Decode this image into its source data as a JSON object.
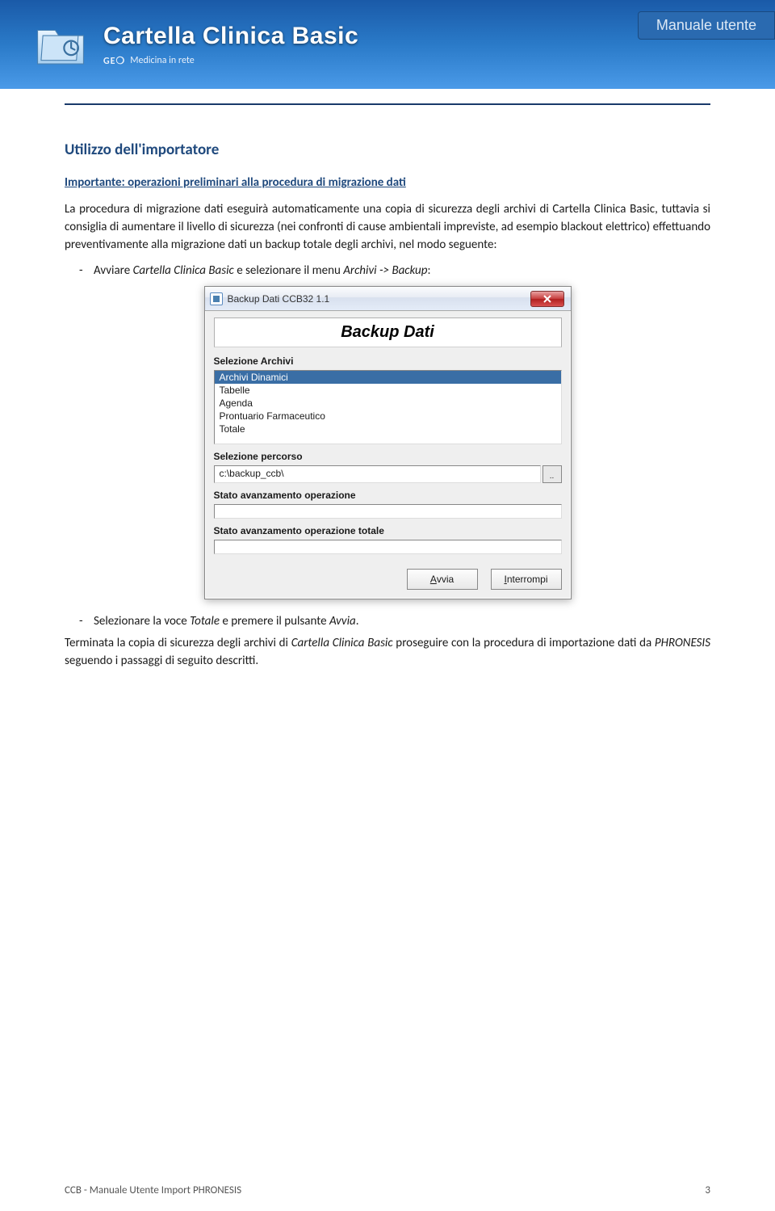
{
  "banner": {
    "title": "Cartella Clinica Basic",
    "sub_brand": "GE❍",
    "sub_tagline": "Medicina in rete",
    "manual_badge": "Manuale utente"
  },
  "section": {
    "heading": "Utilizzo dell'importatore",
    "subheading": "Importante: operazioni preliminari alla procedura di migrazione dati",
    "paragraph1": "La procedura di migrazione dati eseguirà automaticamente una copia di sicurezza degli archivi di Cartella Clinica Basic, tuttavia si consiglia di aumentare il livello di sicurezza (nei confronti di cause ambientali impreviste, ad esempio blackout elettrico) effettuando preventivamente alla migrazione dati un backup totale degli archivi, nel modo seguente:",
    "bullet1_pre": "Avviare ",
    "bullet1_em1": "Cartella Clinica Basic",
    "bullet1_mid": " e selezionare il menu ",
    "bullet1_em2": "Archivi -> Backup",
    "bullet1_post": ":",
    "bullet2_pre": "Selezionare la voce ",
    "bullet2_em1": "Totale",
    "bullet2_mid": " e premere il pulsante ",
    "bullet2_em2": "Avvia",
    "bullet2_post": ".",
    "paragraph2_pre": "Terminata la copia di sicurezza degli archivi di ",
    "paragraph2_em1": "Cartella Clinica Basic",
    "paragraph2_mid": " proseguire con la procedura di importazione dati da ",
    "paragraph2_em2": "PHRONESIS",
    "paragraph2_post": " seguendo i passaggi di seguito descritti."
  },
  "dialog": {
    "title": "Backup Dati CCB32 1.1",
    "header": "Backup Dati",
    "label_archivi": "Selezione Archivi",
    "options": [
      "Archivi Dinamici",
      "Tabelle",
      "Agenda",
      "Prontuario Farmaceutico",
      "Totale"
    ],
    "selected_index": 0,
    "label_percorso": "Selezione percorso",
    "path_value": "c:\\backup_ccb\\",
    "browse_label": "..",
    "label_prog1": "Stato avanzamento operazione",
    "label_prog2": "Stato avanzamento operazione totale",
    "btn_avvia_u": "A",
    "btn_avvia_rest": "vvia",
    "btn_inter_u": "I",
    "btn_inter_rest": "nterrompi"
  },
  "footer": {
    "left": "CCB - Manuale Utente  Import PHRONESIS",
    "page": "3"
  }
}
